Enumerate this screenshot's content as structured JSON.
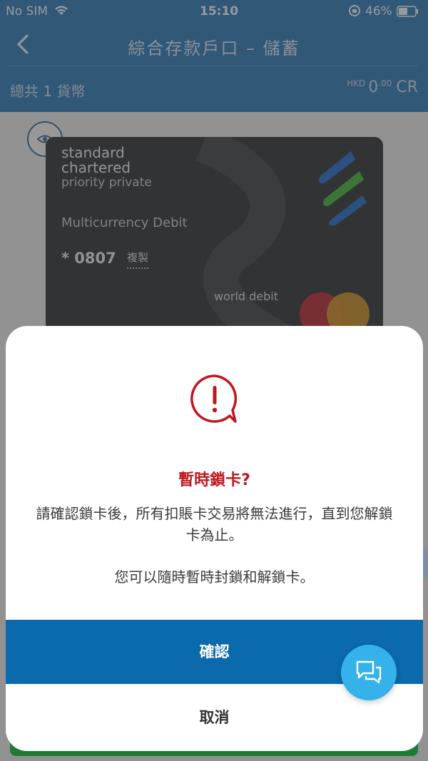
{
  "status_bar": {
    "carrier": "No SIM",
    "time": "15:10",
    "battery_percent": "46%"
  },
  "nav": {
    "title": "綜合存款戶口 – 儲蓄"
  },
  "summary": {
    "total_label": "總共 1 貨幣",
    "currency": "HKD",
    "amount_int": "0",
    "amount_dec": ".00",
    "cr": "CR"
  },
  "card": {
    "brand_line1": "standard",
    "brand_line2": "chartered",
    "brand_line3": "priority private",
    "product": "Multicurrency Debit",
    "number": "* 0807",
    "copy_label": "複製",
    "network": "world debit"
  },
  "modal": {
    "title": "暫時鎖卡?",
    "body1": "請確認鎖卡後，所有扣賬卡交易將無法進行，直到您解鎖卡為止。",
    "body2": "您可以隨時暫時封鎖和解鎖卡。",
    "confirm_label": "確認",
    "cancel_label": "取消"
  },
  "colors": {
    "header_blue": "#2a6fa9",
    "confirm_blue": "#0b6aac",
    "warning_red": "#c0171f",
    "chat_fab": "#35b2ea"
  },
  "icons": [
    "wifi-icon",
    "lock-rotation-icon",
    "battery-icon",
    "back-chevron-icon",
    "eye-icon",
    "sc-logo-icon",
    "mastercard-icon",
    "warning-bubble-icon",
    "chat-icon"
  ]
}
